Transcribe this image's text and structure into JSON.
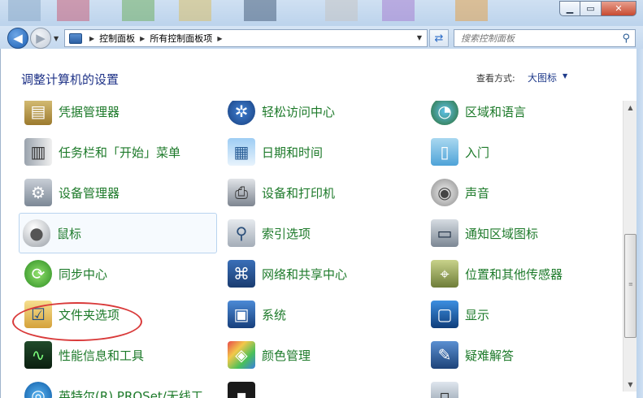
{
  "window": {
    "min_label": "▁",
    "max_label": "▭",
    "close_label": "✕"
  },
  "nav": {
    "breadcrumbs": [
      "控制面板",
      "所有控制面板项"
    ],
    "search_placeholder": "搜索控制面板"
  },
  "header": {
    "title": "调整计算机的设置",
    "view_by_label": "查看方式:",
    "view_by_value": "大图标"
  },
  "items": [
    {
      "label": "凭据管理器",
      "icon": "credential-vault-icon"
    },
    {
      "label": "轻松访问中心",
      "icon": "ease-of-access-icon"
    },
    {
      "label": "区域和语言",
      "icon": "globe-clock-icon"
    },
    {
      "label": "任务栏和「开始」菜单",
      "icon": "taskbar-icon"
    },
    {
      "label": "日期和时间",
      "icon": "calendar-clock-icon"
    },
    {
      "label": "入门",
      "icon": "getting-started-icon"
    },
    {
      "label": "设备管理器",
      "icon": "device-manager-icon"
    },
    {
      "label": "设备和打印机",
      "icon": "printer-icon"
    },
    {
      "label": "声音",
      "icon": "speaker-icon"
    },
    {
      "label": "鼠标",
      "icon": "mouse-icon"
    },
    {
      "label": "索引选项",
      "icon": "magnifier-icon"
    },
    {
      "label": "通知区域图标",
      "icon": "notification-area-icon"
    },
    {
      "label": "同步中心",
      "icon": "sync-icon"
    },
    {
      "label": "网络和共享中心",
      "icon": "network-icon"
    },
    {
      "label": "位置和其他传感器",
      "icon": "sensor-icon"
    },
    {
      "label": "文件夹选项",
      "icon": "folder-options-icon"
    },
    {
      "label": "系统",
      "icon": "system-icon"
    },
    {
      "label": "显示",
      "icon": "display-icon"
    },
    {
      "label": "性能信息和工具",
      "icon": "performance-icon"
    },
    {
      "label": "颜色管理",
      "icon": "color-management-icon"
    },
    {
      "label": "疑难解答",
      "icon": "troubleshooting-icon"
    },
    {
      "label": "英特尔(R) PROSet/无线工",
      "icon": "intel-wireless-icon"
    }
  ]
}
